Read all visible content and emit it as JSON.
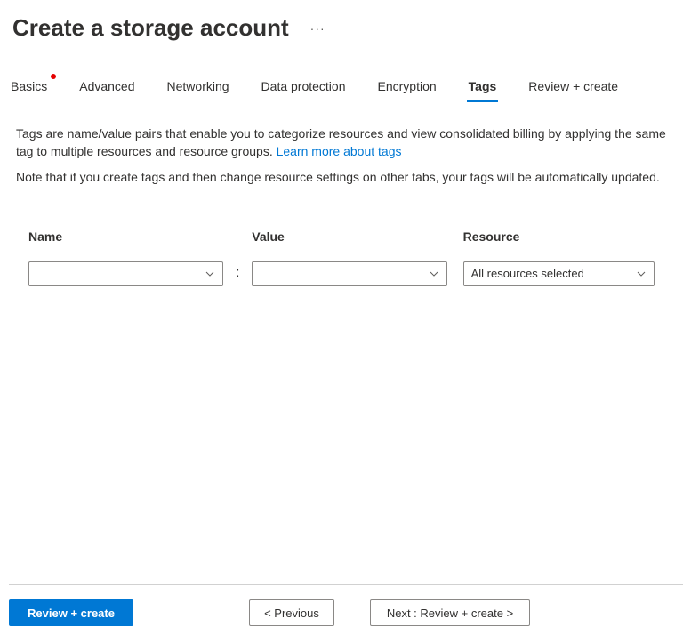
{
  "header": {
    "title": "Create a storage account",
    "more": "···"
  },
  "tabs": {
    "items": [
      {
        "label": "Basics",
        "has_dot": true
      },
      {
        "label": "Advanced"
      },
      {
        "label": "Networking"
      },
      {
        "label": "Data protection"
      },
      {
        "label": "Encryption"
      },
      {
        "label": "Tags",
        "active": true
      },
      {
        "label": "Review + create"
      }
    ]
  },
  "intro": {
    "text": "Tags are name/value pairs that enable you to categorize resources and view consolidated billing by applying the same tag to multiple resources and resource groups. ",
    "link": "Learn more about tags"
  },
  "note": "Note that if you create tags and then change resource settings on other tabs, your tags will be automatically updated.",
  "columns": {
    "name": "Name",
    "sep": ":",
    "value": "Value",
    "resource": "Resource"
  },
  "row": {
    "name_value": "",
    "value_value": "",
    "resource_value": "All resources selected"
  },
  "footer": {
    "review": "Review + create",
    "prev": "< Previous",
    "next": "Next : Review + create >"
  }
}
